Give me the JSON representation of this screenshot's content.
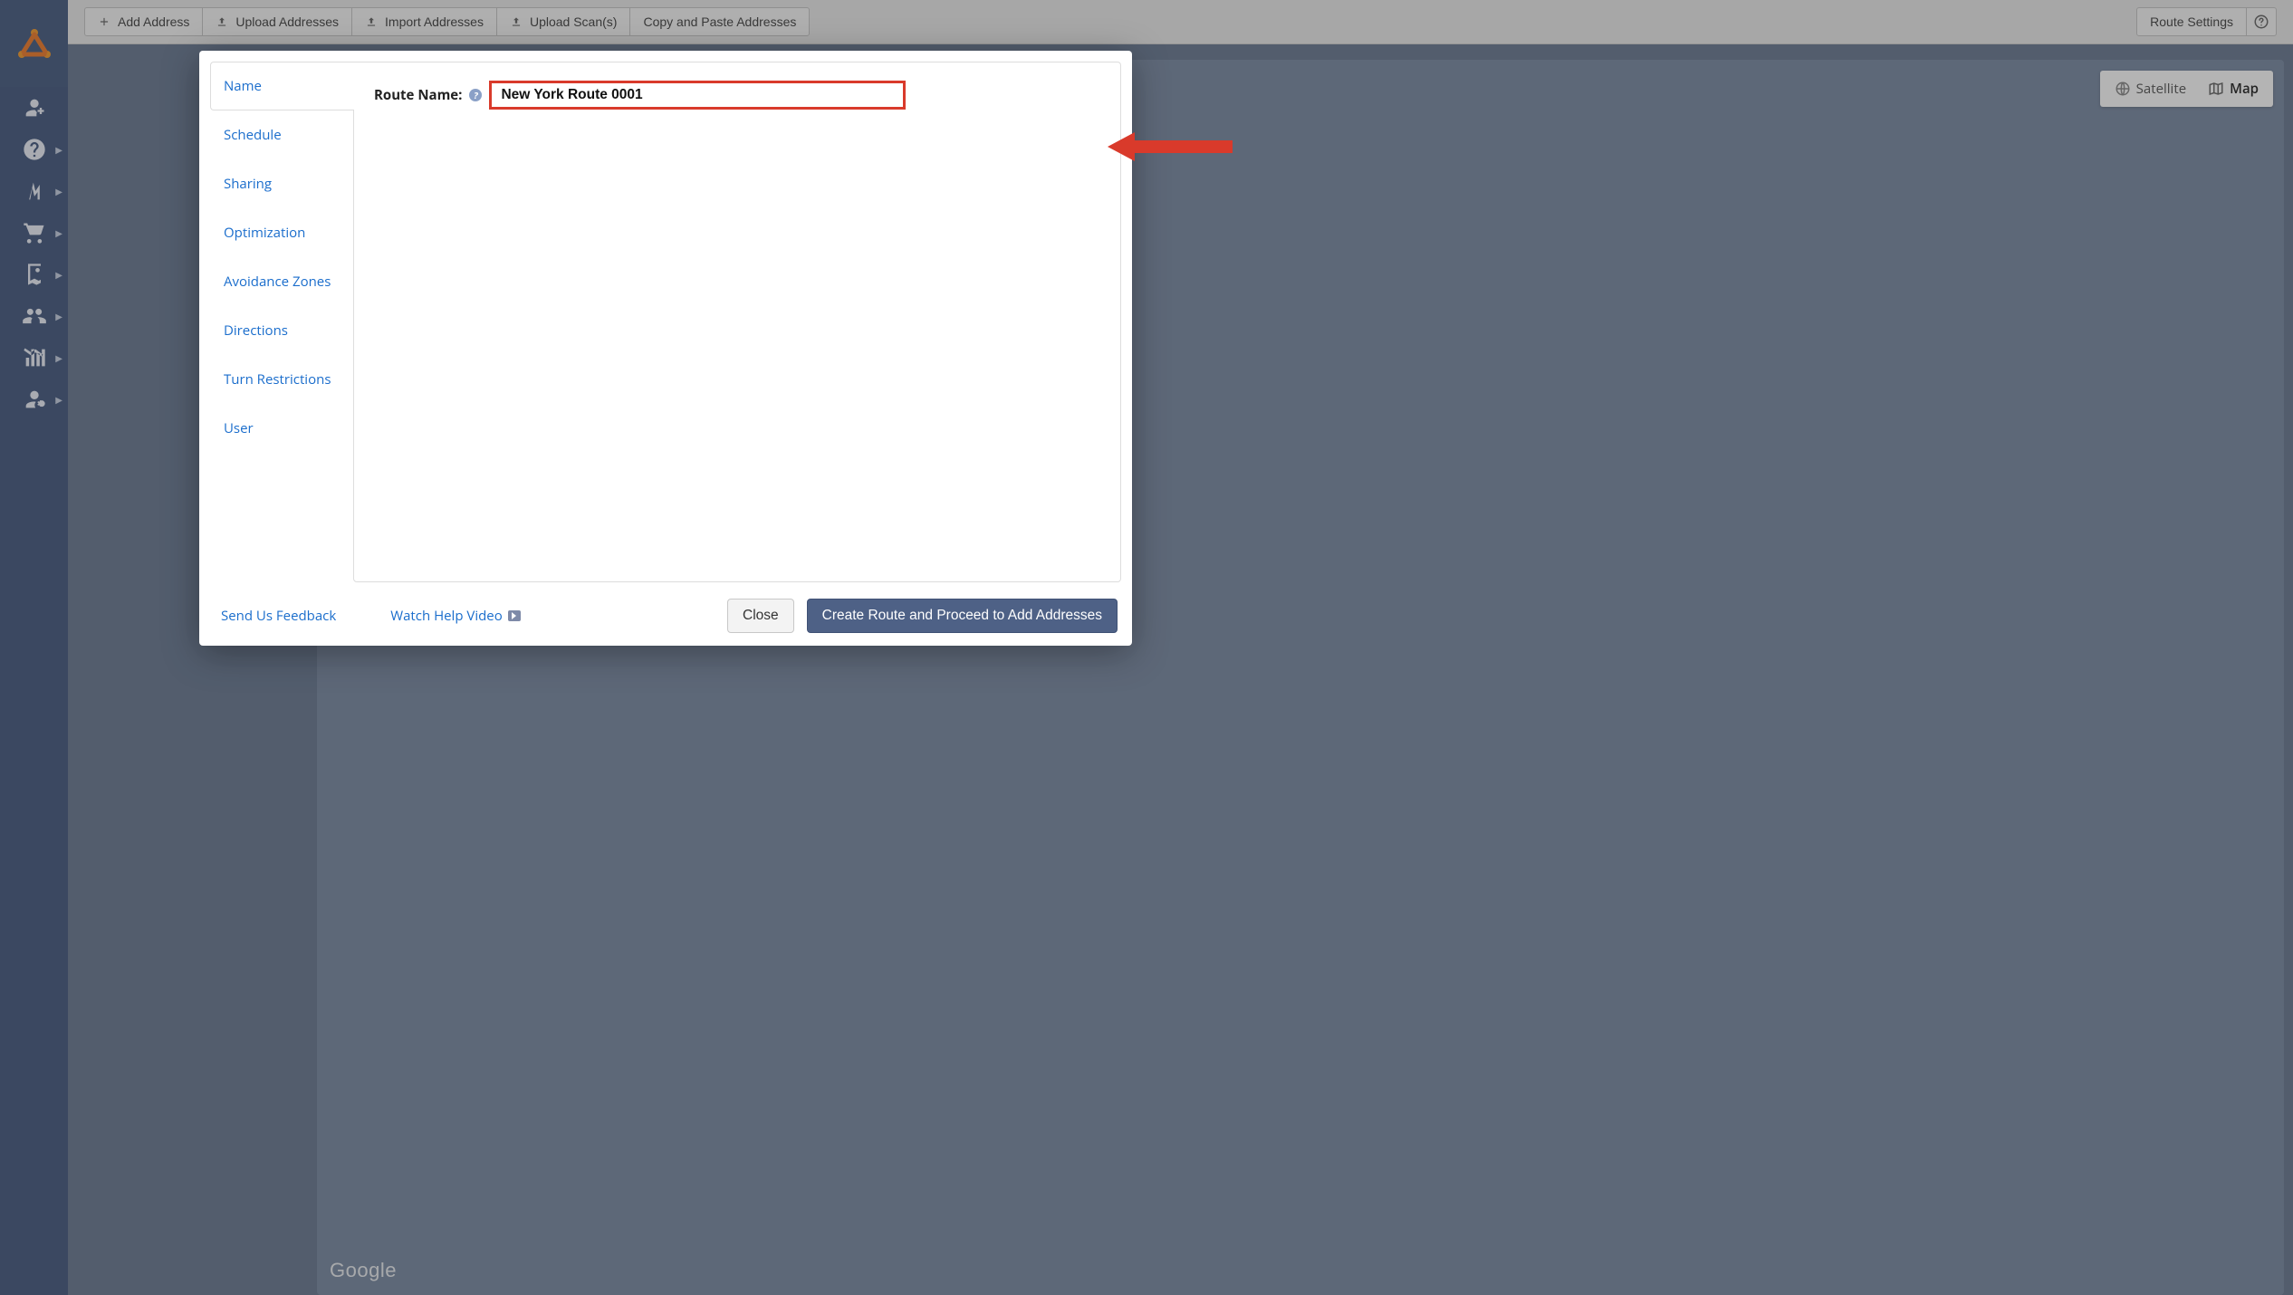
{
  "toolbar": {
    "add_address": "Add Address",
    "upload_addresses": "Upload Addresses",
    "import_addresses": "Import Addresses",
    "upload_scans": "Upload Scan(s)",
    "copy_paste": "Copy and Paste Addresses",
    "route_settings": "Route Settings"
  },
  "map": {
    "satellite": "Satellite",
    "map": "Map",
    "provider": "Google"
  },
  "modal": {
    "tabs": {
      "name": "Name",
      "schedule": "Schedule",
      "sharing": "Sharing",
      "optimization": "Optimization",
      "avoidance": "Avoidance Zones",
      "directions": "Directions",
      "turn_restrictions": "Turn Restrictions",
      "user": "User"
    },
    "route_name_label": "Route Name:",
    "route_name_value": "New York Route 0001",
    "feedback_link": "Send Us Feedback",
    "help_video_link": "Watch Help Video",
    "close_button": "Close",
    "create_button": "Create Route and Proceed to Add Addresses"
  },
  "colors": {
    "accent_red": "#d93a2b",
    "primary_button": "#4e6186",
    "link": "#1a6dcc",
    "nav_bg": "#455a80"
  }
}
